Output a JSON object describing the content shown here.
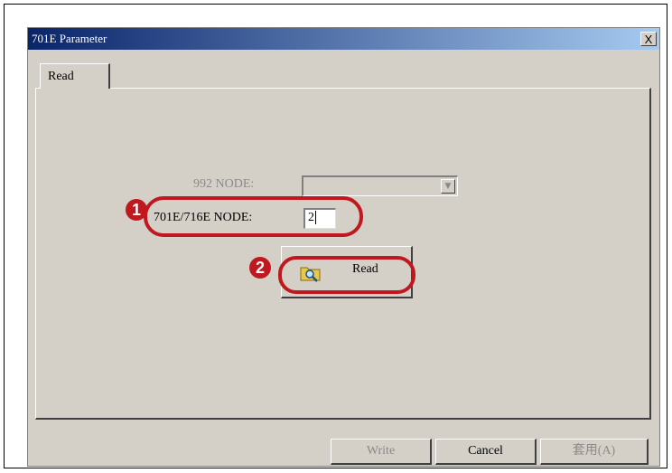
{
  "window": {
    "title": "701E Parameter",
    "close_label": "X"
  },
  "tabs": [
    {
      "label": "Read"
    }
  ],
  "form": {
    "node992_label": "992 NODE:",
    "node992_value": "",
    "node701_label": "701E/716E NODE:",
    "node701_value": "2"
  },
  "read_button": {
    "label": "Read",
    "icon": "folder-search-icon"
  },
  "annotations": [
    {
      "number": "1"
    },
    {
      "number": "2"
    }
  ],
  "buttons": {
    "write": "Write",
    "cancel": "Cancel",
    "apply": "套用(A)"
  },
  "colors": {
    "annotation_red": "#c0181e",
    "dialog_gray": "#d4d0c8",
    "title_start": "#0a246a",
    "title_end": "#a6caf0"
  }
}
